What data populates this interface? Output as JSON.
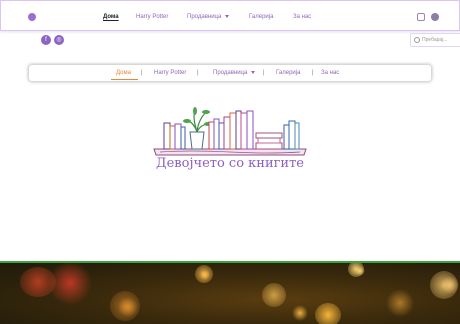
{
  "header": {
    "nav": [
      {
        "label": "Дома",
        "active": true,
        "dropdown": false
      },
      {
        "label": "Harry Potter",
        "active": false,
        "dropdown": false
      },
      {
        "label": "Продавница",
        "active": false,
        "dropdown": true
      },
      {
        "label": "Галерија",
        "active": false,
        "dropdown": false
      },
      {
        "label": "За нас",
        "active": false,
        "dropdown": false
      }
    ],
    "social_icons": [
      "instagram-icon",
      "facebook-icon"
    ]
  },
  "subheader": {
    "social": [
      {
        "icon": "facebook-icon",
        "glyph": "f"
      },
      {
        "icon": "instagram-icon",
        "glyph": "◎"
      }
    ],
    "search": {
      "placeholder": "Пребарај..."
    }
  },
  "secondary_nav": {
    "items": [
      {
        "label": "Дома",
        "active": true,
        "dropdown": false
      },
      {
        "label": "Harry Potter",
        "active": false,
        "dropdown": false
      },
      {
        "label": "Продавница",
        "active": false,
        "dropdown": true
      },
      {
        "label": "Галерија",
        "active": false,
        "dropdown": false
      },
      {
        "label": "За нас",
        "active": false,
        "dropdown": false
      }
    ],
    "separator": "|"
  },
  "brand": {
    "title": "Девојчето со книгите"
  },
  "colors": {
    "accent": "#8c5ec2",
    "active_link": "#e08a3c",
    "divider": "#3ea33e"
  }
}
